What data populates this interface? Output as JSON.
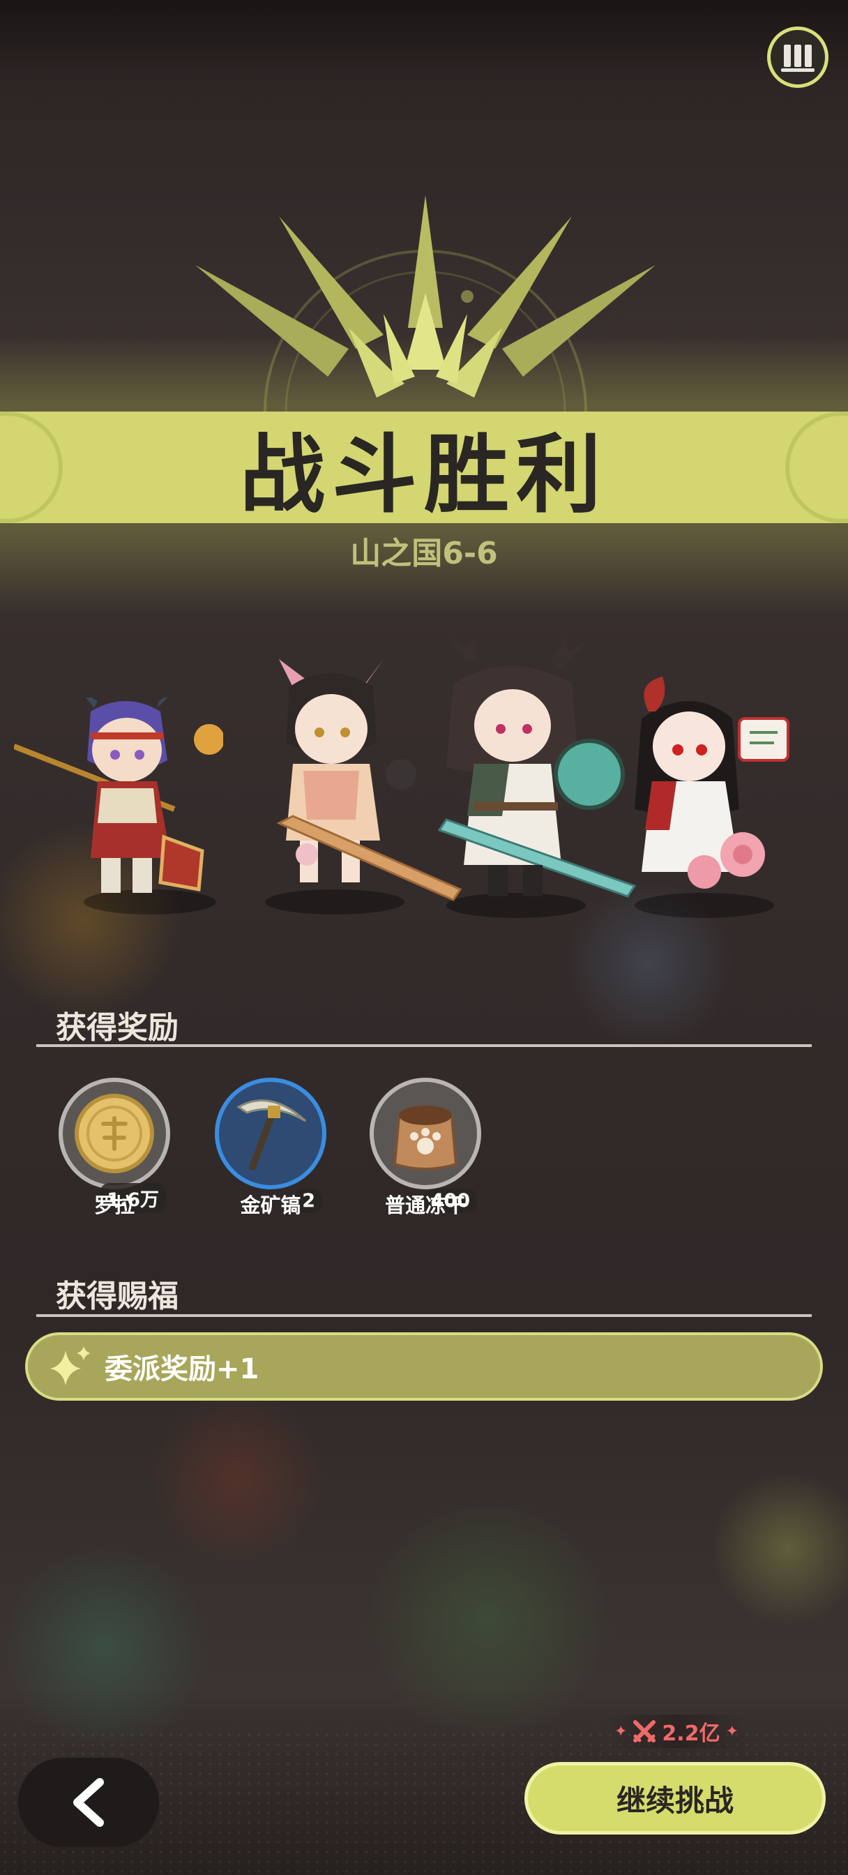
{
  "header": {
    "menu_icon": "book-shelf-icon"
  },
  "result": {
    "title": "战斗胜利",
    "stage": "山之国6-6"
  },
  "team": {
    "characters": [
      {
        "name": "purple-haired-halberd-warrior"
      },
      {
        "name": "pink-horned-sword-girl"
      },
      {
        "name": "antlered-shield-swordswoman"
      },
      {
        "name": "rose-dress-girl-with-sign"
      }
    ]
  },
  "rewards": {
    "title": "获得奖励",
    "items": [
      {
        "name": "罗拉",
        "count": "1.6万",
        "icon": "gold-coin-icon",
        "frame": "grey"
      },
      {
        "name": "金矿镐",
        "count": "2",
        "icon": "pickaxe-icon",
        "frame": "blue"
      },
      {
        "name": "普通冻干",
        "count": "400",
        "icon": "food-sack-icon",
        "frame": "grey"
      }
    ]
  },
  "blessings": {
    "title": "获得赐福",
    "items": [
      {
        "text": "委派奖励+1",
        "icon": "sparkle-icon"
      }
    ]
  },
  "footer": {
    "back_icon": "chevron-left-icon",
    "power_icon": "crossed-swords-icon",
    "power_value": "2.2亿",
    "continue_label": "继续挑战"
  },
  "colors": {
    "accent": "#d3d671",
    "background": "#2f2827",
    "pickaxe_frame": "#3a8de0",
    "power_text": "#f06a6a"
  }
}
